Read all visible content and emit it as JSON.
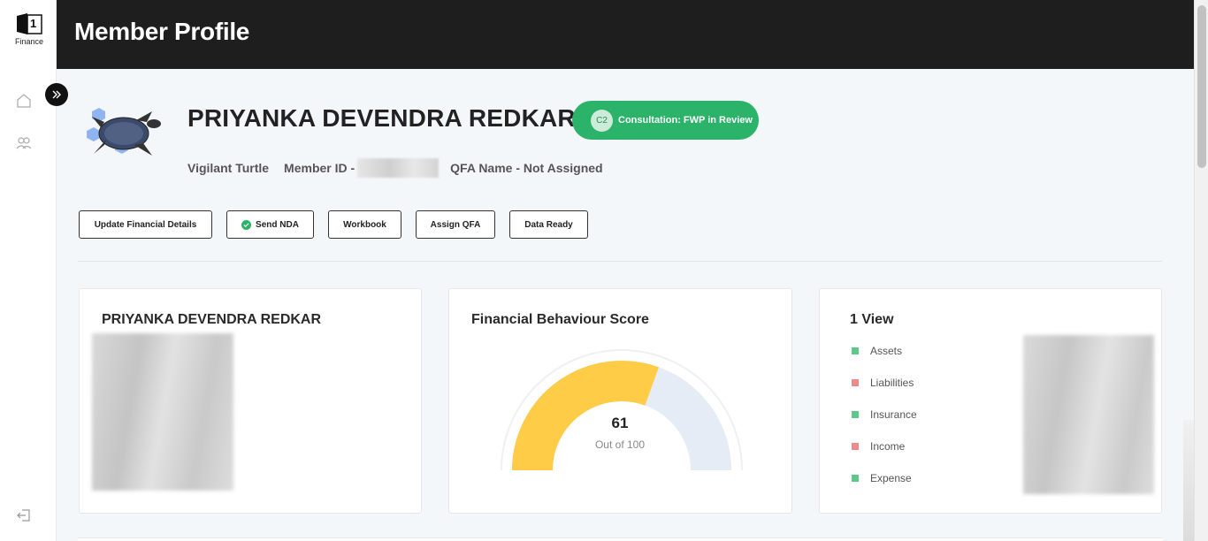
{
  "sidebar": {
    "logo_number": "1",
    "logo_text": "Finance",
    "icons": [
      "home-icon",
      "users-icon",
      "logout-icon"
    ],
    "toggle_icon": "chevrons-right-icon"
  },
  "header": {
    "title": "Member Profile"
  },
  "profile": {
    "name": "PRIYANKA DEVENDRA REDKAR",
    "status_code": "C2",
    "status_label": "Consultation: FWP in Review",
    "persona": "Vigilant Turtle",
    "member_id_label": "Member ID -",
    "qfa_label": "QFA Name - Not Assigned"
  },
  "actions": {
    "update_financial": "Update Financial Details",
    "send_nda": "Send NDA",
    "workbook": "Workbook",
    "assign_qfa": "Assign QFA",
    "data_ready": "Data Ready"
  },
  "cards": {
    "member": {
      "title": "PRIYANKA DEVENDRA REDKAR"
    },
    "score": {
      "title": "Financial Behaviour Score",
      "value": "61",
      "subtitle": "Out of 100",
      "fraction": 0.61,
      "fill_color": "#ffcc47",
      "track_color": "#e6ecf5"
    },
    "view": {
      "title": "1 View",
      "items": [
        {
          "label": "Assets",
          "color": "#5cc98a"
        },
        {
          "label": "Liabilities",
          "color": "#ef8a8a"
        },
        {
          "label": "Insurance",
          "color": "#5cc98a"
        },
        {
          "label": "Income",
          "color": "#ef8a8a"
        },
        {
          "label": "Expense",
          "color": "#5cc98a"
        }
      ]
    }
  },
  "colors": {
    "header_bg": "#1e1e1f",
    "accent_green": "#2bb36a"
  }
}
